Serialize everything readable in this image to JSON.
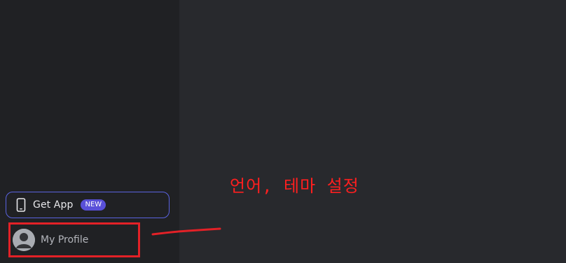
{
  "sidebar": {
    "get_app": {
      "label": "Get App",
      "badge": "NEW",
      "icon": "phone-icon"
    },
    "profile": {
      "label": "My Profile",
      "icon": "avatar-icon"
    }
  },
  "annotation": {
    "text": "언어, 테마 설정",
    "color": "#ff1f1f"
  },
  "colors": {
    "sidebar_bg": "#202124",
    "main_bg": "#28292d",
    "accent_border": "#5a63e0",
    "badge_bg": "#5950d8",
    "highlight_red": "#e32127"
  }
}
